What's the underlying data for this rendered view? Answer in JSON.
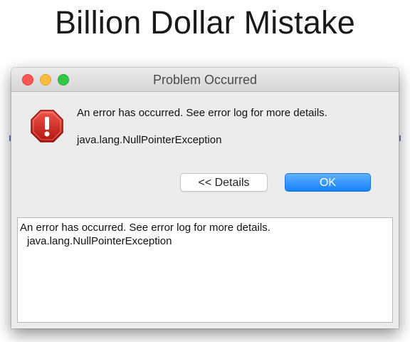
{
  "slide": {
    "title": "Billion Dollar Mistake"
  },
  "window": {
    "title": "Problem Occurred"
  },
  "dialog": {
    "message": "An error has occurred. See error log for more details.",
    "exception": "java.lang.NullPointerException",
    "icon": "error-stop-icon",
    "buttons": {
      "details_label": "<< Details",
      "ok_label": "OK"
    }
  },
  "details": {
    "line1": "An error has occurred. See error log for more details.",
    "line2": "java.lang.NullPointerException"
  },
  "colors": {
    "ok_button": "#1681fc",
    "close": "#fc5753",
    "minimize": "#fdbc40",
    "maximize": "#33c748",
    "error_icon": "#d9251d"
  }
}
